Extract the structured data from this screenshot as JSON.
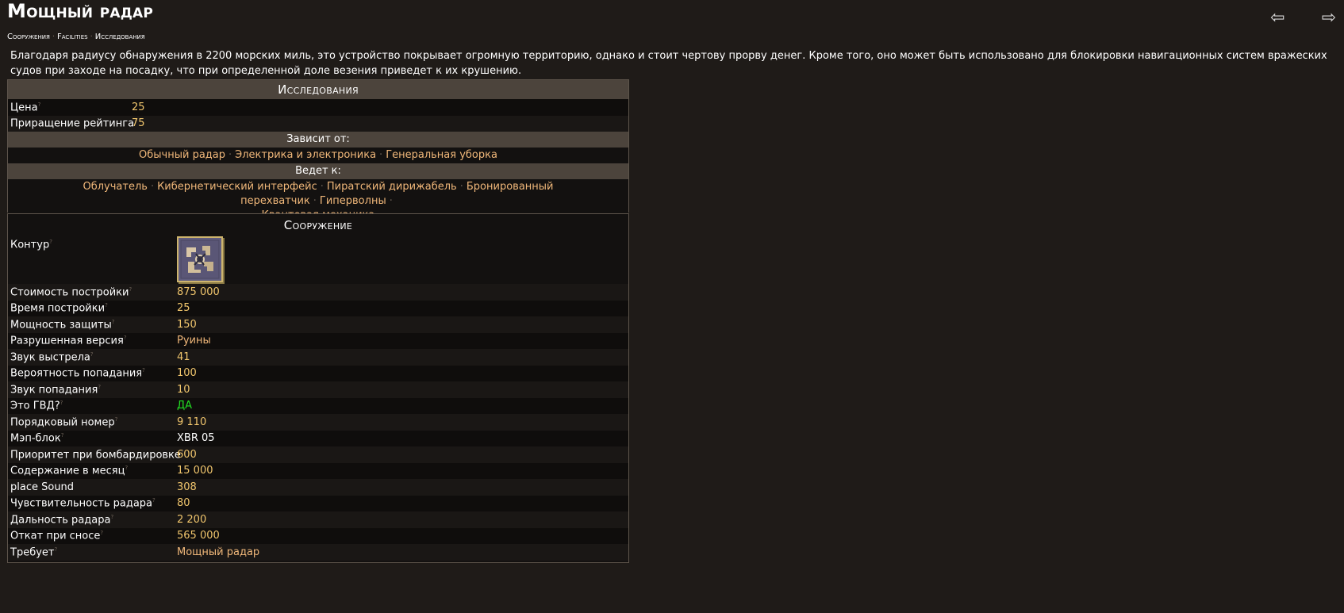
{
  "title": "Мощный радар",
  "breadcrumb": [
    "Сооружения",
    "Facilities",
    "Исследования"
  ],
  "nav": {
    "back": "⇦",
    "forward": "⇨"
  },
  "description": "Благодаря радиусу обнаружения в 2200 морских миль, это устройство покрывает огромную территорию, однако и стоит чертову прорву денег. Кроме того, оно может быть использовано для блокировки навигационных систем вражеских судов при заходе на посадку, что при определенной доле везения приведет к их крушению.",
  "research": {
    "header": "Исследования",
    "rows": [
      {
        "label": "Цена",
        "value": "25"
      },
      {
        "label": "Приращение рейтинга",
        "value": "75"
      }
    ],
    "depends_header": "Зависит от:",
    "depends": [
      "Обычный радар",
      "Электрика и электроника",
      "Генеральная уборка"
    ],
    "leads_header": "Ведет к:",
    "leads": [
      "Облучатель",
      "Кибернетический интерфейс",
      "Пиратский дирижабель",
      "Бронированный перехватчик",
      "Гиперволны",
      "Квантовая механика"
    ]
  },
  "building": {
    "header": "Сооружение",
    "contour_label": "Контур",
    "rows": [
      {
        "label": "Стоимость постройки",
        "value": "875 000"
      },
      {
        "label": "Время постройки",
        "value": "25"
      },
      {
        "label": "Мощность защиты",
        "value": "150"
      },
      {
        "label": "Разрушенная версия",
        "value": "Руины"
      },
      {
        "label": "Звук выстрела",
        "value": "41"
      },
      {
        "label": "Вероятность попадания",
        "value": "100"
      },
      {
        "label": "Звук попадания",
        "value": "10"
      },
      {
        "label": "Это ГВД?",
        "value": "ДА"
      },
      {
        "label": "Порядковый номер",
        "value": "9 110"
      },
      {
        "label": "Мэп-блок",
        "value": "XBR 05"
      },
      {
        "label": "Приоритет при бомбардировке",
        "value": "600"
      },
      {
        "label": "Содержание в месяц",
        "value": "15 000"
      },
      {
        "label": "place Sound",
        "value": "308"
      },
      {
        "label": "Чувствительность радара",
        "value": "80"
      },
      {
        "label": "Дальность радара",
        "value": "2 200"
      },
      {
        "label": "Откат при сносе",
        "value": "565 000"
      },
      {
        "label": "Требует",
        "value": "Мощный радар"
      }
    ]
  },
  "colors": {
    "background": "#1f1b18",
    "value": "#f1c66d",
    "link": "#f1b87a",
    "yes": "#22dd22",
    "header_bg": "#4c443c"
  }
}
